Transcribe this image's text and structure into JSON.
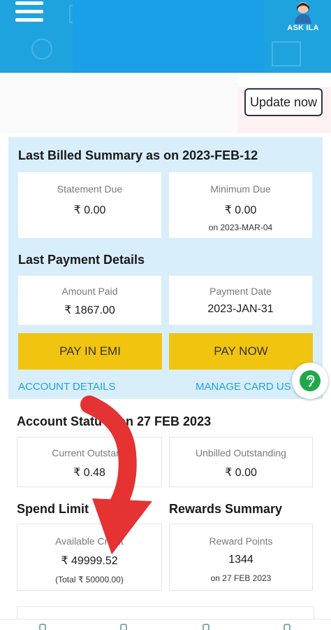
{
  "header": {
    "ask_label": "ASK ILA"
  },
  "update": {
    "button_label": "Update now"
  },
  "billed_summary": {
    "title": "Last Billed Summary as on 2023-FEB-12",
    "statement_due_label": "Statement Due",
    "statement_due_value": "₹ 0.00",
    "minimum_due_label": "Minimum Due",
    "minimum_due_value": "₹ 0.00",
    "minimum_due_date": "on 2023-MAR-04"
  },
  "payment": {
    "title": "Last Payment Details",
    "amount_label": "Amount Paid",
    "amount_value": "₹ 1867.00",
    "date_label": "Payment Date",
    "date_value": "2023-JAN-31"
  },
  "actions": {
    "pay_emi": "PAY IN EMI",
    "pay_now": "PAY NOW",
    "account_details": "ACCOUNT DETAILS",
    "manage_card": "MANAGE CARD US"
  },
  "account_status": {
    "title_part1": "Account Statu",
    "title_part2": "s on 27 FEB 2023",
    "current_label": "Current Outstand",
    "current_value": "₹ 0.48",
    "unbilled_label": "Unbilled Outstanding",
    "unbilled_value": "₹ 0.00"
  },
  "spend_limit": {
    "title": "Spend Limit",
    "available_label": "Available Credit",
    "available_value": "₹ 49999.52",
    "total": "(Total ₹ 50000.00)"
  },
  "rewards": {
    "title": "Rewards Summary",
    "points_label": "Reward Points",
    "points_value": "1344",
    "points_date": "on 27 FEB 2023"
  },
  "colors": {
    "header_blue": "#1fa3df",
    "panel_blue": "#d9eefb",
    "pay_yellow": "#f1c40f",
    "link_blue": "#1ba3e0",
    "arrow_red": "#e53232",
    "chat_green": "#1fa84a"
  },
  "icons": [
    "hamburger-menu-icon",
    "ask-ila-avatar-icon",
    "chat-hearing-icon",
    "red-arrow-annotation"
  ]
}
